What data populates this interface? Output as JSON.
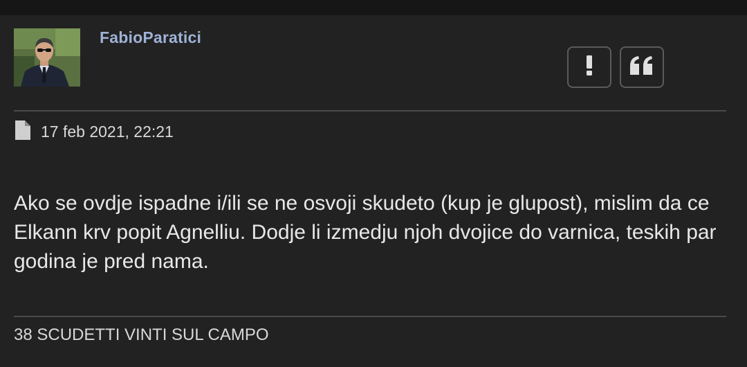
{
  "post": {
    "author": {
      "username": "FabioParatici"
    },
    "actions": [
      {
        "name": "report-button",
        "icon": "exclamation-icon"
      },
      {
        "name": "quote-button",
        "icon": "quote-icon"
      }
    ],
    "date_icon": "file-icon",
    "date": "17 feb 2021, 22:21",
    "message": "Ako se ovdje ispadne i/ili se ne osvoji skudeto (kup je glupost), mislim da ce Elkann krv popit Agnelliu. Dodje li izmedju njoh dvojice do varnica, teskih par godina je pred nama.",
    "signature": "38 SCUDETTI VINTI SUL CAMPO"
  },
  "colors": {
    "background": "#222222",
    "username": "#9fb2d6",
    "text": "#e8e8e8",
    "divider": "#4a4a4a",
    "button_border": "#5b5b5b"
  }
}
